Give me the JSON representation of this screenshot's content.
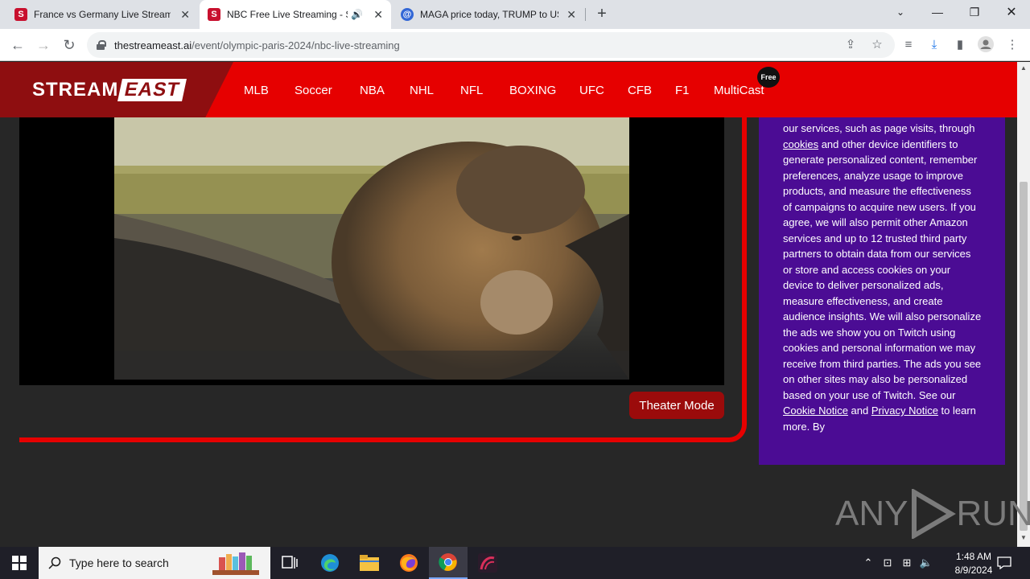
{
  "browser": {
    "tabs": [
      {
        "title": "France vs Germany Live Streamin",
        "favicon": "S",
        "color": "#c8102e"
      },
      {
        "title": "NBC Free Live Streaming - S",
        "favicon": "S",
        "color": "#c8102e",
        "active": true
      },
      {
        "title": "MAGA price today, TRUMP to US",
        "favicon": "@",
        "color": "#3367d6"
      }
    ],
    "url_host": "thestreameast.ai",
    "url_path": "/event/olympic-paris-2024/nbc-live-streaming"
  },
  "site": {
    "logo_left": "STREAM",
    "logo_right": "EAST",
    "nav": [
      "MLB",
      "Soccer",
      "NBA",
      "NHL",
      "NFL",
      "BOXING",
      "UFC",
      "CFB",
      "F1",
      "MultiCast"
    ],
    "free_badge": "Free",
    "accent": "#e60000",
    "logo_bg": "#8e0e10"
  },
  "player": {
    "theater_label": "Theater Mode"
  },
  "consent": {
    "bg": "#4b0c94",
    "text_1": "our services, such as page visits, through ",
    "link_cookies": "cookies",
    "text_2": " and other device identifiers to generate personalized content, remember preferences, analyze usage to improve products, and measure the effectiveness of campaigns to acquire new users. If you agree, we will also permit other Amazon services and up to 12 trusted third party partners to obtain data from our services or store and access cookies on your device to deliver personalized ads, measure effectiveness, and create audience insights. We will also personalize the ads we show you on Twitch using cookies and personal information we may receive from third parties. The ads you see on other sites may also be personalized based on your use of Twitch. See our ",
    "link_cookie_notice": "Cookie Notice",
    "text_3": " and ",
    "link_privacy": "Privacy Notice",
    "text_4": " to learn more. By"
  },
  "watermark": {
    "left": "ANY",
    "right": "RUN"
  },
  "taskbar": {
    "search_placeholder": "Type here to search",
    "time": "1:48 AM",
    "date": "8/9/2024"
  }
}
